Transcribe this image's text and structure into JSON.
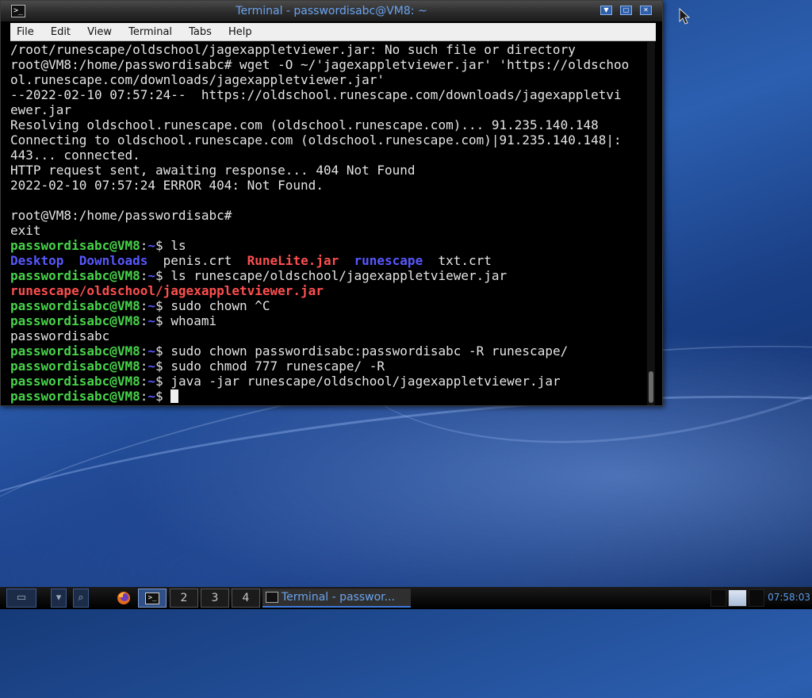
{
  "window": {
    "title": "Terminal - passwordisabc@VM8: ~",
    "buttons": [
      "▼",
      "▢",
      "✕"
    ]
  },
  "menu": [
    "File",
    "Edit",
    "View",
    "Terminal",
    "Tabs",
    "Help"
  ],
  "terminal": {
    "lines": [
      [
        {
          "t": "/root/runescape/oldschool/jagexappletviewer.jar: No such file or directory",
          "c": ""
        }
      ],
      [
        {
          "t": "root@VM8:/home/passwordisabc# wget -O ~/'jagexappletviewer.jar' 'https://oldschoo",
          "c": ""
        }
      ],
      [
        {
          "t": "ol.runescape.com/downloads/jagexappletviewer.jar'",
          "c": ""
        }
      ],
      [
        {
          "t": "--2022-02-10 07:57:24--  https://oldschool.runescape.com/downloads/jagexappletvi",
          "c": ""
        }
      ],
      [
        {
          "t": "ewer.jar",
          "c": ""
        }
      ],
      [
        {
          "t": "Resolving oldschool.runescape.com (oldschool.runescape.com)... 91.235.140.148",
          "c": ""
        }
      ],
      [
        {
          "t": "Connecting to oldschool.runescape.com (oldschool.runescape.com)|91.235.140.148|:",
          "c": ""
        }
      ],
      [
        {
          "t": "443... connected.",
          "c": ""
        }
      ],
      [
        {
          "t": "HTTP request sent, awaiting response... 404 Not Found",
          "c": ""
        }
      ],
      [
        {
          "t": "2022-02-10 07:57:24 ERROR 404: Not Found.",
          "c": ""
        }
      ],
      [
        {
          "t": "",
          "c": ""
        }
      ],
      [
        {
          "t": "root@VM8:/home/passwordisabc#",
          "c": ""
        }
      ],
      [
        {
          "t": "exit",
          "c": ""
        }
      ],
      [
        {
          "t": "passwordisabc@VM8",
          "c": "g"
        },
        {
          "t": ":",
          "c": ""
        },
        {
          "t": "~",
          "c": "b"
        },
        {
          "t": "$ ls",
          "c": ""
        }
      ],
      [
        {
          "t": "Desktop",
          "c": "b"
        },
        {
          "t": "  ",
          "c": ""
        },
        {
          "t": "Downloads",
          "c": "b"
        },
        {
          "t": "  penis.crt  ",
          "c": ""
        },
        {
          "t": "RuneLite.jar",
          "c": "r"
        },
        {
          "t": "  ",
          "c": ""
        },
        {
          "t": "runescape",
          "c": "b"
        },
        {
          "t": "  txt.crt",
          "c": ""
        }
      ],
      [
        {
          "t": "passwordisabc@VM8",
          "c": "g"
        },
        {
          "t": ":",
          "c": ""
        },
        {
          "t": "~",
          "c": "b"
        },
        {
          "t": "$ ls runescape/oldschool/jagexappletviewer.jar",
          "c": ""
        }
      ],
      [
        {
          "t": "runescape/oldschool/jagexappletviewer.jar",
          "c": "r"
        }
      ],
      [
        {
          "t": "passwordisabc@VM8",
          "c": "g"
        },
        {
          "t": ":",
          "c": ""
        },
        {
          "t": "~",
          "c": "b"
        },
        {
          "t": "$ sudo chown ^C",
          "c": ""
        }
      ],
      [
        {
          "t": "passwordisabc@VM8",
          "c": "g"
        },
        {
          "t": ":",
          "c": ""
        },
        {
          "t": "~",
          "c": "b"
        },
        {
          "t": "$ whoami",
          "c": ""
        }
      ],
      [
        {
          "t": "passwordisabc",
          "c": ""
        }
      ],
      [
        {
          "t": "passwordisabc@VM8",
          "c": "g"
        },
        {
          "t": ":",
          "c": ""
        },
        {
          "t": "~",
          "c": "b"
        },
        {
          "t": "$ sudo chown passwordisabc:passwordisabc -R runescape/",
          "c": ""
        }
      ],
      [
        {
          "t": "passwordisabc@VM8",
          "c": "g"
        },
        {
          "t": ":",
          "c": ""
        },
        {
          "t": "~",
          "c": "b"
        },
        {
          "t": "$ sudo chmod 777 runescape/ -R",
          "c": ""
        }
      ],
      [
        {
          "t": "passwordisabc@VM8",
          "c": "g"
        },
        {
          "t": ":",
          "c": ""
        },
        {
          "t": "~",
          "c": "b"
        },
        {
          "t": "$ java -jar runescape/oldschool/jagexappletviewer.jar",
          "c": ""
        }
      ],
      [
        {
          "t": "passwordisabc@VM8",
          "c": "g"
        },
        {
          "t": ":",
          "c": ""
        },
        {
          "t": "~",
          "c": "b"
        },
        {
          "t": "$ ",
          "c": ""
        }
      ]
    ]
  },
  "taskbar": {
    "workspaces": [
      "1",
      "2",
      "3",
      "4"
    ],
    "active_workspace": "1",
    "task_title": "Terminal - passwor...",
    "clock": "07:58:03"
  },
  "colors": {
    "prompt_user": "#47d34a",
    "directory": "#5858ff",
    "archive": "#ff4e4e",
    "title": "#6ba3ee"
  }
}
